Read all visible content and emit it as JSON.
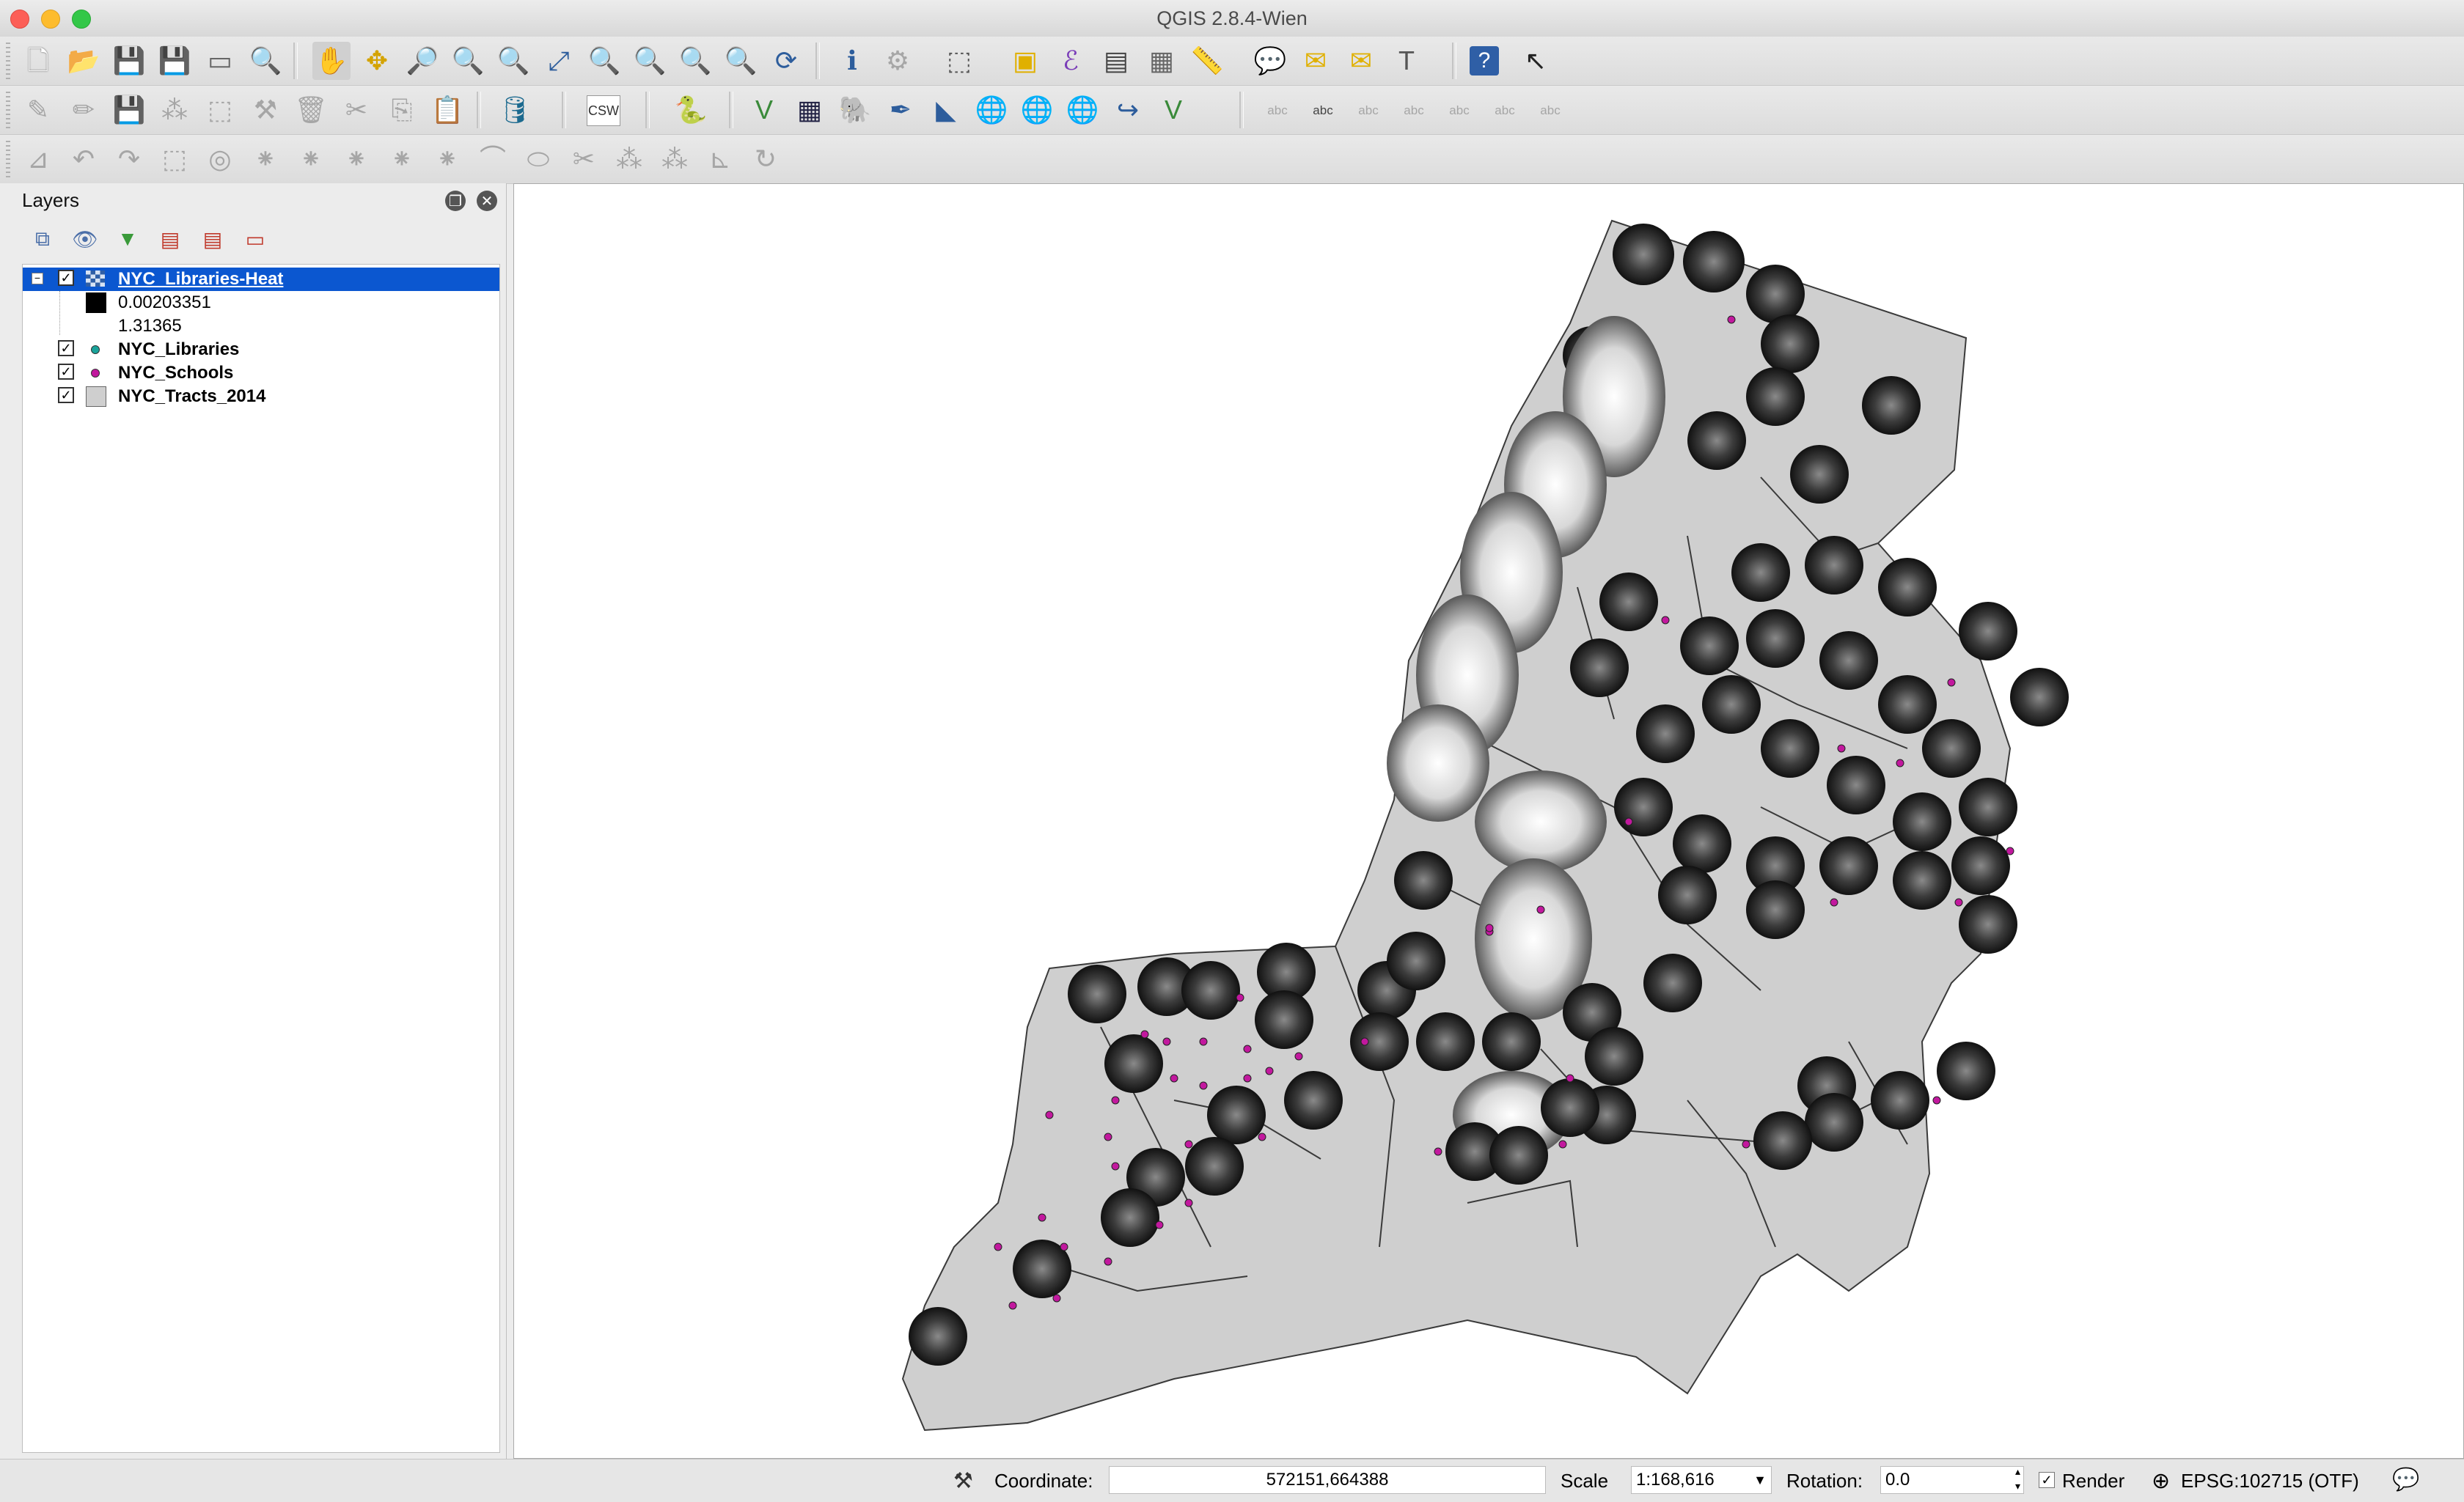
{
  "window": {
    "title": "QGIS 2.8.4-Wien"
  },
  "toolbars": {
    "row1": [
      "new-project-icon",
      "open-project-icon",
      "save-project-icon",
      "save-as-icon",
      "new-print-composer-icon",
      "composer-manager-icon",
      "pan-icon",
      "pan-to-selection-icon",
      "zoom-in-icon",
      "zoom-out-icon",
      "zoom-native-icon",
      "zoom-full-icon",
      "zoom-to-selection-icon",
      "zoom-to-layer-icon",
      "zoom-last-icon",
      "zoom-next-icon",
      "refresh-icon",
      "identify-icon",
      "action-icon",
      "select-icon",
      "deselect-icon",
      "field-calculator-icon",
      "attribute-table-icon",
      "statistics-icon",
      "measure-icon",
      "map-tips-icon",
      "new-bookmark-icon",
      "show-bookmarks-icon",
      "text-annotation-icon",
      "help-icon",
      "whats-this-icon"
    ],
    "row2_text": {
      "csw": "CSW"
    },
    "label_tool_text": "abc"
  },
  "layers_panel": {
    "title": "Layers",
    "layers": [
      {
        "name": "NYC_Libraries-Heat",
        "checked": true,
        "selected": true,
        "legend": [
          "0.00203351",
          "1.31365"
        ]
      },
      {
        "name": "NYC_Libraries",
        "checked": true,
        "symbol_color": "#1aa39a"
      },
      {
        "name": "NYC_Schools",
        "checked": true,
        "symbol_color": "#c2189e"
      },
      {
        "name": "NYC_Tracts_2014",
        "checked": true,
        "symbol_color": "#cfcfcf"
      }
    ]
  },
  "status_bar": {
    "coordinate_label": "Coordinate:",
    "coordinate_value": "572151,664388",
    "scale_label": "Scale",
    "scale_value": "1:168,616",
    "rotation_label": "Rotation:",
    "rotation_value": "0.0",
    "render_label": "Render",
    "render_checked": true,
    "crs_label": "EPSG:102715 (OTF)"
  },
  "colors": {
    "selection": "#0b57d0",
    "tract_fill": "#cfcfcf",
    "tract_stroke": "#3a3a3a",
    "school_point": "#c2189e"
  }
}
